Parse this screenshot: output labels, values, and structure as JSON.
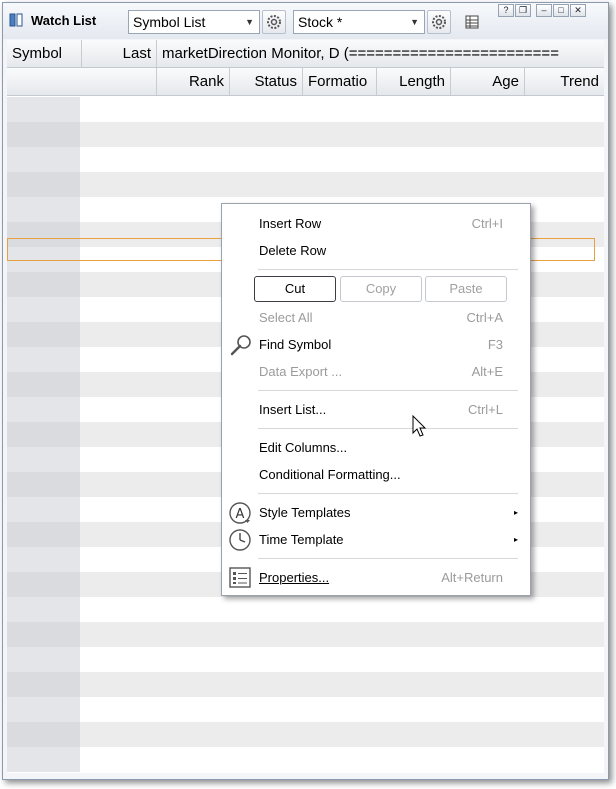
{
  "window": {
    "title": "Watch List"
  },
  "toolbar": {
    "list_combo": "Symbol List",
    "type_combo": "Stock *"
  },
  "grid": {
    "header_row1": [
      "Symbol",
      "Last",
      "marketDirection Monitor, D (========================"
    ],
    "header_row2": [
      "Rank",
      "Status",
      "Formatio",
      "Length",
      "Age",
      "Trend"
    ]
  },
  "context_menu": {
    "insert_row": {
      "label": "Insert Row",
      "shortcut": "Ctrl+I"
    },
    "delete_row": {
      "label": "Delete Row"
    },
    "cut": "Cut",
    "copy": "Copy",
    "paste": "Paste",
    "select_all": {
      "label": "Select All",
      "shortcut": "Ctrl+A"
    },
    "find_symbol": {
      "label": "Find Symbol",
      "shortcut": "F3"
    },
    "data_export": {
      "label": "Data Export ...",
      "shortcut": "Alt+E"
    },
    "insert_list": {
      "label": "Insert List...",
      "shortcut": "Ctrl+L"
    },
    "edit_columns": {
      "label": "Edit Columns..."
    },
    "conditional_formatting": {
      "label": "Conditional Formatting..."
    },
    "style_templates": {
      "label": "Style Templates"
    },
    "time_template": {
      "label": "Time Template"
    },
    "properties": {
      "label": "Properties...",
      "shortcut": "Alt+Return"
    }
  },
  "colors": {
    "selection_border": "#e8a040",
    "row_alt": "#ececec"
  }
}
